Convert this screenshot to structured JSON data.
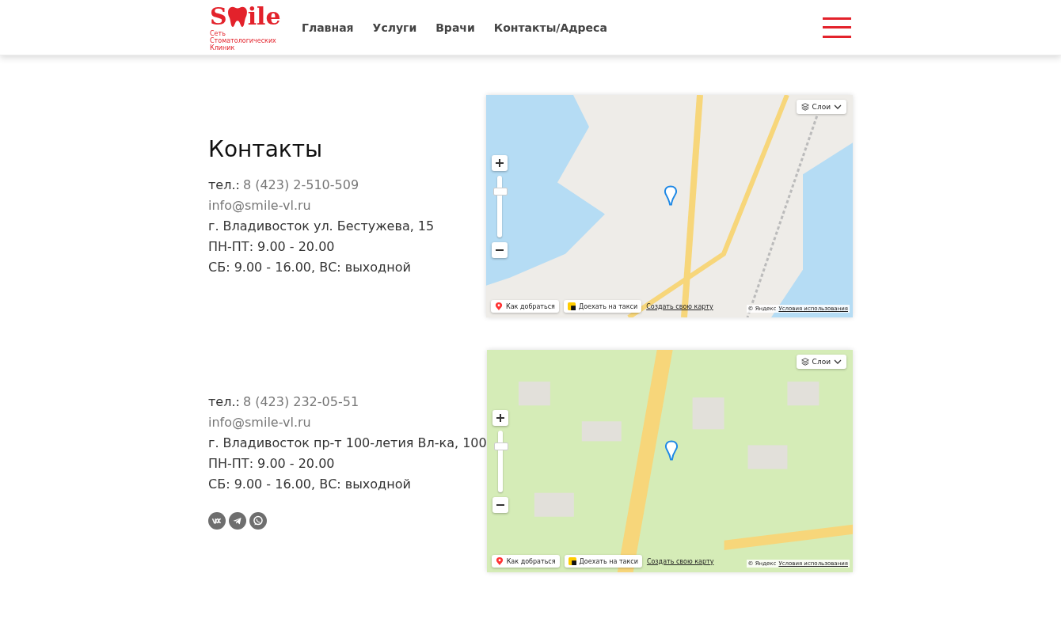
{
  "header": {
    "logo": {
      "before": "S",
      "after": "ile",
      "subtitle": "Сеть Стоматологических Клиник"
    },
    "nav": [
      {
        "label": "Главная"
      },
      {
        "label": "Услуги"
      },
      {
        "label": "Врачи"
      },
      {
        "label": "Контакты/Адреса"
      }
    ]
  },
  "title": "Контакты",
  "branches": [
    {
      "phone_label": "тел.:",
      "phone": "8 (423) 2-510-509",
      "email": "info@smile-vl.ru",
      "address": "г. Владивосток ул. Бестужева, 15",
      "hours": [
        "ПН-ПТ: 9.00 - 20.00",
        "СБ: 9.00 - 16.00, ВС: выходной"
      ],
      "map": {
        "kind": "sea",
        "zoom": {
          "level": 0.78
        },
        "layers": "Слои",
        "route": "Как добраться",
        "taxi": "Доехать на такси",
        "create": "Создать свою карту",
        "copyright": "© Яндекс",
        "terms": "Условия использования"
      }
    },
    {
      "phone_label": "тел.:",
      "phone": "8 (423) 232-05-51",
      "email": "info@smile-vl.ru",
      "address": "г. Владивосток пр-т 100-летия Вл-ка, 100",
      "hours": [
        "ПН-ПТ: 9.00 - 20.00",
        "СБ: 9.00 - 16.00, ВС: выходной"
      ],
      "socials": [
        {
          "kind": "vk"
        },
        {
          "kind": "telegram"
        },
        {
          "kind": "whatsapp"
        }
      ],
      "map": {
        "kind": "green",
        "zoom": {
          "level": 0.78
        },
        "layers": "Слои",
        "route": "Как добраться",
        "taxi": "Доехать на такси",
        "create": "Создать свою карту",
        "copyright": "© Яндекс",
        "terms": "Условия использования"
      }
    }
  ]
}
